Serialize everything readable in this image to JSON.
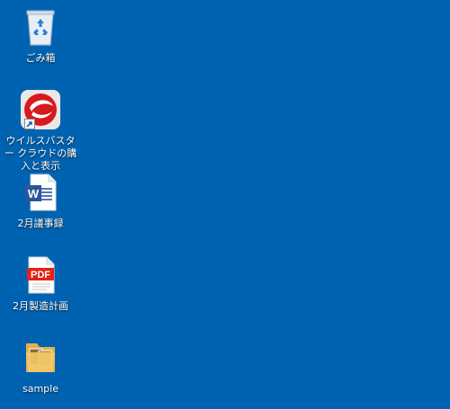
{
  "desktop": {
    "background_color": "#0063b1",
    "icons": [
      {
        "label": "ごみ箱",
        "icon": "recycle-bin-icon"
      },
      {
        "label": "ウイルスバスター クラウドの購入と表示",
        "icon": "virus-buster-shortcut-icon"
      },
      {
        "label": "2月議事録",
        "icon": "word-document-icon"
      },
      {
        "label": "2月製造計画",
        "icon": "pdf-document-icon"
      },
      {
        "label": "sample",
        "icon": "folder-icon"
      }
    ],
    "pdf_badge_text": "PDF",
    "word_badge_text": "W"
  }
}
